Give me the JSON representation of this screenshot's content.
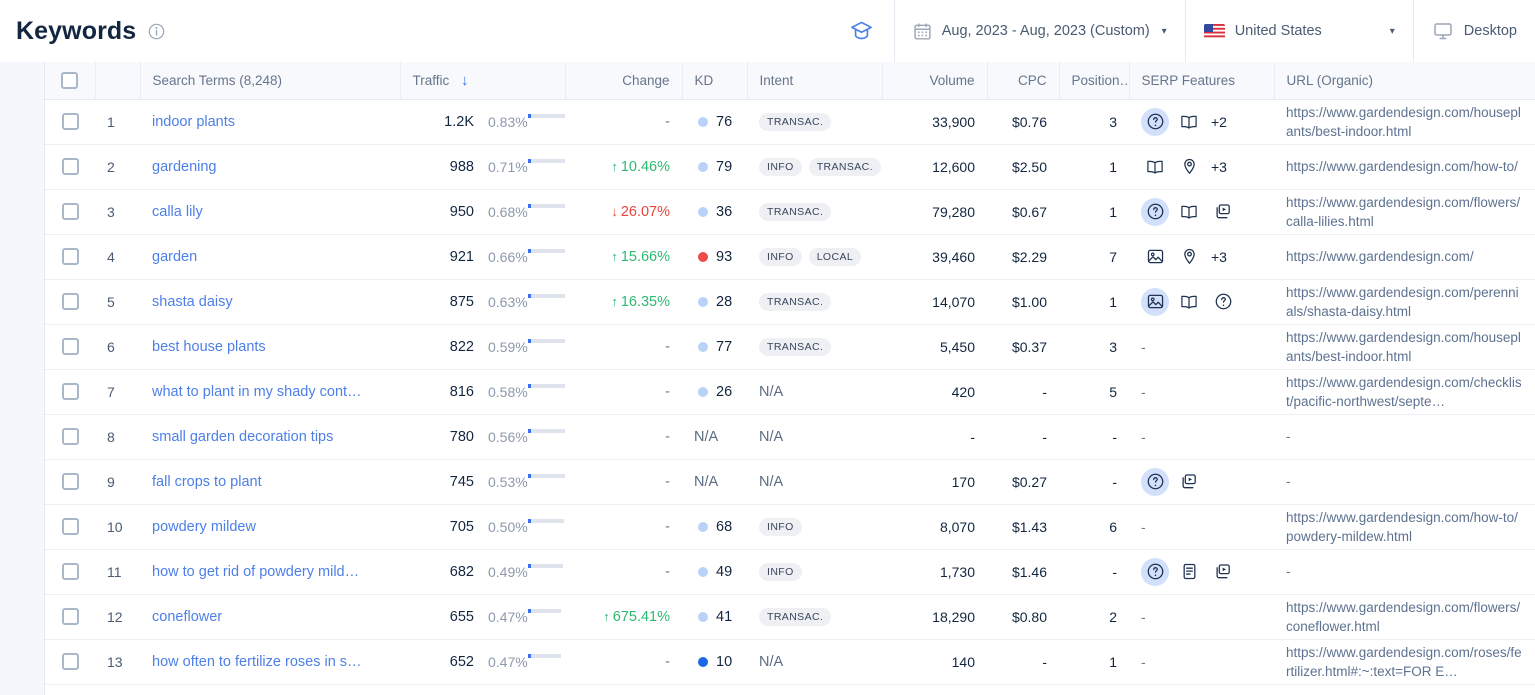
{
  "header": {
    "title": "Keywords",
    "info_icon": "info-circle-icon",
    "academy_icon": "graduation-cap-icon",
    "date_range": {
      "icon": "calendar-icon",
      "label": "Aug, 2023 - Aug, 2023 (Custom)",
      "caret": "▾"
    },
    "country": {
      "icon": "us-flag-icon",
      "label": "United States",
      "caret": "▾"
    },
    "device": {
      "icon": "desktop-icon",
      "label": "Desktop"
    }
  },
  "table": {
    "columns": [
      {
        "key": "checkbox",
        "label": ""
      },
      {
        "key": "num",
        "label": ""
      },
      {
        "key": "term",
        "label": "Search Terms (8,248)"
      },
      {
        "key": "traffic",
        "label": "Traffic",
        "sort": "↓"
      },
      {
        "key": "change",
        "label": "Change"
      },
      {
        "key": "kd",
        "label": "KD"
      },
      {
        "key": "intent",
        "label": "Intent"
      },
      {
        "key": "volume",
        "label": "Volume"
      },
      {
        "key": "cpc",
        "label": "CPC"
      },
      {
        "key": "position",
        "label": "Position…"
      },
      {
        "key": "serp",
        "label": "SERP Features"
      },
      {
        "key": "url",
        "label": "URL (Organic)"
      }
    ],
    "rows": [
      {
        "num": "1",
        "term": "indoor plants",
        "traffic": "1.2K",
        "traffic_pct": "0.83%",
        "bar": 100,
        "change": "-",
        "change_dir": "none",
        "kd": "76",
        "kd_color": "#b9d2f7",
        "intents": [
          "TRANSAC."
        ],
        "volume": "33,900",
        "cpc": "$0.76",
        "position": "3",
        "serp": [
          {
            "icon": "people-also-ask-icon",
            "highlight": true
          },
          {
            "icon": "knowledge-panel-icon",
            "highlight": false
          }
        ],
        "serp_more": "+2",
        "url": "https://www.gardendesign.com/houseplants/best-indoor.html"
      },
      {
        "num": "2",
        "term": "gardening",
        "traffic": "988",
        "traffic_pct": "0.71%",
        "bar": 86,
        "change": "10.46%",
        "change_dir": "up",
        "kd": "79",
        "kd_color": "#b9d2f7",
        "intents": [
          "INFO",
          "TRANSAC."
        ],
        "volume": "12,600",
        "cpc": "$2.50",
        "position": "1",
        "serp": [
          {
            "icon": "knowledge-panel-icon",
            "highlight": false
          },
          {
            "icon": "local-pack-icon",
            "highlight": false
          }
        ],
        "serp_more": "+3",
        "url": "https://www.gardendesign.com/how-to/"
      },
      {
        "num": "3",
        "term": "calla lily",
        "traffic": "950",
        "traffic_pct": "0.68%",
        "bar": 82,
        "change": "26.07%",
        "change_dir": "down",
        "kd": "36",
        "kd_color": "#b9d2f7",
        "intents": [
          "TRANSAC."
        ],
        "volume": "79,280",
        "cpc": "$0.67",
        "position": "1",
        "serp": [
          {
            "icon": "people-also-ask-icon",
            "highlight": true
          },
          {
            "icon": "knowledge-panel-icon",
            "highlight": false
          },
          {
            "icon": "video-carousel-icon",
            "highlight": false
          }
        ],
        "serp_more": "",
        "url": "https://www.gardendesign.com/flowers/calla-lilies.html"
      },
      {
        "num": "4",
        "term": "garden",
        "traffic": "921",
        "traffic_pct": "0.66%",
        "bar": 80,
        "change": "15.66%",
        "change_dir": "up",
        "kd": "93",
        "kd_color": "#ef4b4b",
        "intents": [
          "INFO",
          "LOCAL"
        ],
        "volume": "39,460",
        "cpc": "$2.29",
        "position": "7",
        "serp": [
          {
            "icon": "image-pack-icon",
            "highlight": false
          },
          {
            "icon": "local-pack-icon",
            "highlight": false
          }
        ],
        "serp_more": "+3",
        "url": "https://www.gardendesign.com/"
      },
      {
        "num": "5",
        "term": "shasta daisy",
        "traffic": "875",
        "traffic_pct": "0.63%",
        "bar": 76,
        "change": "16.35%",
        "change_dir": "up",
        "kd": "28",
        "kd_color": "#b9d2f7",
        "intents": [
          "TRANSAC."
        ],
        "volume": "14,070",
        "cpc": "$1.00",
        "position": "1",
        "serp": [
          {
            "icon": "image-pack-icon",
            "highlight": true
          },
          {
            "icon": "knowledge-panel-icon",
            "highlight": false
          },
          {
            "icon": "people-also-ask-icon",
            "highlight": false
          }
        ],
        "serp_more": "",
        "url": "https://www.gardendesign.com/perennials/shasta-daisy.html"
      },
      {
        "num": "6",
        "term": "best house plants",
        "traffic": "822",
        "traffic_pct": "0.59%",
        "bar": 71,
        "change": "-",
        "change_dir": "none",
        "kd": "77",
        "kd_color": "#b9d2f7",
        "intents": [
          "TRANSAC."
        ],
        "volume": "5,450",
        "cpc": "$0.37",
        "position": "3",
        "serp": [],
        "serp_more": "",
        "serp_empty": "-",
        "url": "https://www.gardendesign.com/houseplants/best-indoor.html"
      },
      {
        "num": "7",
        "term": "what to plant in my shady cont…",
        "traffic": "816",
        "traffic_pct": "0.58%",
        "bar": 70,
        "change": "-",
        "change_dir": "none",
        "kd": "26",
        "kd_color": "#b9d2f7",
        "intents": [],
        "intent_na": "N/A",
        "volume": "420",
        "cpc": "-",
        "position": "5",
        "serp": [],
        "serp_more": "",
        "serp_empty": "-",
        "url": "https://www.gardendesign.com/checklist/pacific-northwest/septe…"
      },
      {
        "num": "8",
        "term": "small garden decoration tips",
        "traffic": "780",
        "traffic_pct": "0.56%",
        "bar": 67,
        "change": "-",
        "change_dir": "none",
        "kd": "N/A",
        "kd_color": "",
        "intents": [],
        "intent_na": "N/A",
        "volume": "-",
        "cpc": "-",
        "position": "-",
        "serp": [],
        "serp_more": "",
        "serp_empty": "-",
        "url": "-"
      },
      {
        "num": "9",
        "term": "fall crops to plant",
        "traffic": "745",
        "traffic_pct": "0.53%",
        "bar": 64,
        "change": "-",
        "change_dir": "none",
        "kd": "N/A",
        "kd_color": "",
        "intents": [],
        "intent_na": "N/A",
        "volume": "170",
        "cpc": "$0.27",
        "position": "-",
        "serp": [
          {
            "icon": "people-also-ask-icon",
            "highlight": true
          },
          {
            "icon": "video-carousel-icon",
            "highlight": false
          }
        ],
        "serp_more": "",
        "url": "-"
      },
      {
        "num": "10",
        "term": "powdery mildew",
        "traffic": "705",
        "traffic_pct": "0.50%",
        "bar": 60,
        "change": "-",
        "change_dir": "none",
        "kd": "68",
        "kd_color": "#b9d2f7",
        "intents": [
          "INFO"
        ],
        "volume": "8,070",
        "cpc": "$1.43",
        "position": "6",
        "serp": [],
        "serp_more": "",
        "serp_empty": "-",
        "url": "https://www.gardendesign.com/how-to/powdery-mildew.html"
      },
      {
        "num": "11",
        "term": "how to get rid of powdery mild…",
        "traffic": "682",
        "traffic_pct": "0.49%",
        "bar": 59,
        "change": "-",
        "change_dir": "none",
        "kd": "49",
        "kd_color": "#b9d2f7",
        "intents": [
          "INFO"
        ],
        "volume": "1,730",
        "cpc": "$1.46",
        "position": "-",
        "serp": [
          {
            "icon": "people-also-ask-icon",
            "highlight": true
          },
          {
            "icon": "featured-snippet-icon",
            "highlight": false
          },
          {
            "icon": "video-carousel-icon",
            "highlight": false
          }
        ],
        "serp_more": "",
        "url": "-"
      },
      {
        "num": "12",
        "term": "coneflower",
        "traffic": "655",
        "traffic_pct": "0.47%",
        "bar": 56,
        "change": "675.41%",
        "change_dir": "up",
        "kd": "41",
        "kd_color": "#b9d2f7",
        "intents": [
          "TRANSAC."
        ],
        "volume": "18,290",
        "cpc": "$0.80",
        "position": "2",
        "serp": [],
        "serp_more": "",
        "serp_empty": "-",
        "url": "https://www.gardendesign.com/flowers/coneflower.html"
      },
      {
        "num": "13",
        "term": "how often to fertilize roses in s…",
        "traffic": "652",
        "traffic_pct": "0.47%",
        "bar": 56,
        "change": "-",
        "change_dir": "none",
        "kd": "10",
        "kd_color": "#1b68e8",
        "intents": [],
        "intent_na": "N/A",
        "volume": "140",
        "cpc": "-",
        "position": "1",
        "serp": [],
        "serp_more": "",
        "serp_empty": "-",
        "url": "https://www.gardendesign.com/roses/fertilizer.html#:~:text=FOR E…"
      }
    ]
  },
  "colors": {
    "accent_blue": "#3a6ff0",
    "link_blue": "#4d7fe8",
    "up_green": "#2eb872",
    "down_red": "#e8453c",
    "kd_light": "#b9d2f7",
    "kd_red": "#ef4b4b",
    "kd_blue": "#1b68e8",
    "header_bg": "#f7f9fc"
  }
}
